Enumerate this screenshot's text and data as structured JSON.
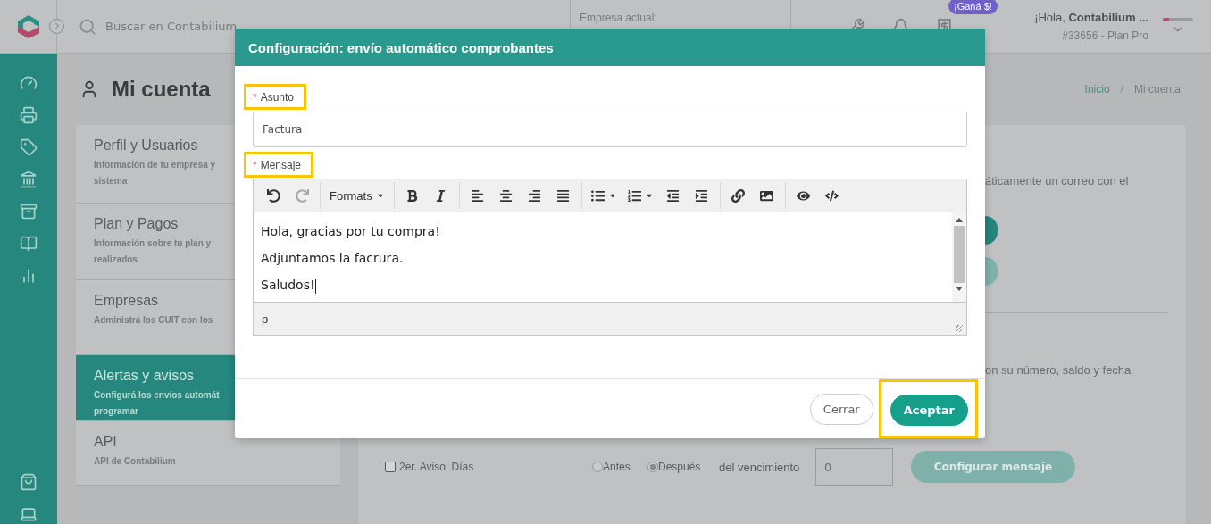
{
  "topbar": {
    "search_placeholder": "Buscar en Contabilium",
    "company_label": "Empresa actual:",
    "promo_badge": "¡Ganá $!",
    "greeting": "¡Hola, **Contabilium ...**",
    "account": "#33656 - Plan Pro"
  },
  "page": {
    "title": "Mi cuenta",
    "breadcrumb_separator": "/",
    "breadcrumb": [
      {
        "label": "Inicio",
        "selected": false
      },
      {
        "label": "Mi cuenta",
        "selected": true
      }
    ]
  },
  "account_menu": [
    {
      "title": "Perfil y Usuarios",
      "description_lines": [
        "Información de tu empresa y",
        "sistema"
      ],
      "selected": false
    },
    {
      "title": "Plan y Pagos",
      "description_lines": [
        "Información sobre tu plan y",
        "realizados"
      ],
      "selected": false
    },
    {
      "title": "Empresas",
      "description_lines": [
        "Administrá los CUIT con los"
      ],
      "selected": false
    },
    {
      "title": "Alertas y avisos",
      "description_lines": [
        "Configurá los envíos automát",
        "programar"
      ],
      "selected": true
    },
    {
      "title": "API",
      "description_lines": [
        "API de Contabilium"
      ],
      "selected": false
    }
  ],
  "alerts_panel": {
    "intro_text": "áticamente un correo con el",
    "section_text": "on su número, saldo y fecha",
    "reminders": [
      {
        "label": "2er. Aviso: Días",
        "checked": false,
        "options": [
          {
            "label": "Antes",
            "selected": false
          },
          {
            "label": "Después",
            "selected": true
          }
        ],
        "suffix": "del vencimiento",
        "days": "0",
        "button": "Configurar mensaje"
      }
    ]
  },
  "modal": {
    "title": "Configuración: envío automático comprobantes",
    "subject": {
      "label": "Asunto",
      "required_mark": "*",
      "highlighted": true,
      "value": "Factura"
    },
    "editor": {
      "label": "Mensaje",
      "required_mark": "*",
      "highlighted": true,
      "toolbar": [
        [
          {
            "kind": "undo",
            "disabled": false
          },
          {
            "kind": "redo",
            "disabled": true
          }
        ],
        [
          {
            "kind": "formats",
            "label": "Formats",
            "disabled": false
          }
        ],
        [
          {
            "kind": "bold",
            "disabled": false
          },
          {
            "kind": "italic",
            "disabled": false
          }
        ],
        [
          {
            "kind": "align-left",
            "disabled": false
          },
          {
            "kind": "align-center",
            "disabled": false
          },
          {
            "kind": "align-right",
            "disabled": false
          },
          {
            "kind": "align-justify",
            "disabled": false
          }
        ],
        [
          {
            "kind": "bullet-list",
            "disabled": false
          },
          {
            "kind": "numbered-list",
            "disabled": false
          },
          {
            "kind": "outdent",
            "disabled": false
          },
          {
            "kind": "indent",
            "disabled": false
          }
        ],
        [
          {
            "kind": "link",
            "disabled": false
          },
          {
            "kind": "image",
            "disabled": false
          }
        ],
        [
          {
            "kind": "preview",
            "disabled": false
          },
          {
            "kind": "code",
            "disabled": false
          }
        ]
      ],
      "paragraphs": [
        "Hola, gracias por tu compra!",
        "Adjuntamos la facrura.",
        "Saludos!"
      ],
      "path": "p"
    },
    "buttons": [
      {
        "label": "Cerrar",
        "kind": "secondary",
        "highlighted": false
      },
      {
        "label": "Aceptar",
        "kind": "primary",
        "highlighted": true
      }
    ]
  }
}
